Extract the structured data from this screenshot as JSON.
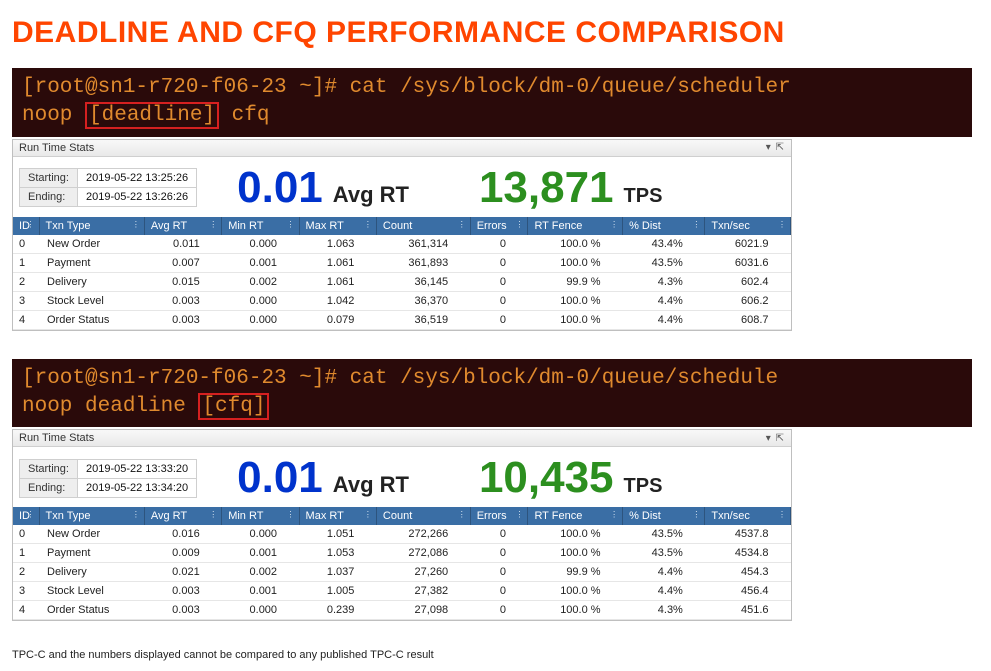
{
  "page": {
    "title": "DEADLINE AND CFQ PERFORMANCE COMPARISON",
    "footnote": "TPC-C and the numbers displayed cannot be compared to any published TPC-C result"
  },
  "panels": [
    {
      "terminal": {
        "line1_prompt": "[root@sn1-r720-f06-23 ~]# ",
        "line1_cmd": "cat /sys/block/dm-0/queue/scheduler",
        "line2_pre": "noop ",
        "line2_boxed": "[deadline]",
        "line2_post": " cfq"
      },
      "panel_title": "Run Time Stats",
      "times": {
        "starting_label": "Starting:",
        "starting": "2019-05-22 13:25:26",
        "ending_label": "Ending:",
        "ending": "2019-05-22 13:26:26"
      },
      "metrics": {
        "avg_rt": "0.01",
        "avg_rt_label": "Avg RT",
        "tps": "13,871",
        "tps_label": "TPS"
      },
      "columns": [
        "ID",
        "Txn Type",
        "Avg RT",
        "Min RT",
        "Max RT",
        "Count",
        "Errors",
        "RT Fence",
        "% Dist",
        "Txn/sec"
      ],
      "rows": [
        {
          "id": "0",
          "type": "New Order",
          "avg": "0.011",
          "min": "0.000",
          "max": "1.063",
          "count": "361,314",
          "errors": "0",
          "fence": "100.0 %",
          "dist": "43.4%",
          "tps": "6021.9"
        },
        {
          "id": "1",
          "type": "Payment",
          "avg": "0.007",
          "min": "0.001",
          "max": "1.061",
          "count": "361,893",
          "errors": "0",
          "fence": "100.0 %",
          "dist": "43.5%",
          "tps": "6031.6"
        },
        {
          "id": "2",
          "type": "Delivery",
          "avg": "0.015",
          "min": "0.002",
          "max": "1.061",
          "count": "36,145",
          "errors": "0",
          "fence": "99.9 %",
          "dist": "4.3%",
          "tps": "602.4"
        },
        {
          "id": "3",
          "type": "Stock Level",
          "avg": "0.003",
          "min": "0.000",
          "max": "1.042",
          "count": "36,370",
          "errors": "0",
          "fence": "100.0 %",
          "dist": "4.4%",
          "tps": "606.2"
        },
        {
          "id": "4",
          "type": "Order Status",
          "avg": "0.003",
          "min": "0.000",
          "max": "0.079",
          "count": "36,519",
          "errors": "0",
          "fence": "100.0 %",
          "dist": "4.4%",
          "tps": "608.7"
        }
      ]
    },
    {
      "terminal": {
        "line1_prompt": "[root@sn1-r720-f06-23 ~]# ",
        "line1_cmd": "cat /sys/block/dm-0/queue/schedule",
        "line2_pre": "noop deadline ",
        "line2_boxed": "[cfq]",
        "line2_post": ""
      },
      "panel_title": "Run Time Stats",
      "times": {
        "starting_label": "Starting:",
        "starting": "2019-05-22 13:33:20",
        "ending_label": "Ending:",
        "ending": "2019-05-22 13:34:20"
      },
      "metrics": {
        "avg_rt": "0.01",
        "avg_rt_label": "Avg RT",
        "tps": "10,435",
        "tps_label": "TPS"
      },
      "columns": [
        "ID",
        "Txn Type",
        "Avg RT",
        "Min RT",
        "Max RT",
        "Count",
        "Errors",
        "RT Fence",
        "% Dist",
        "Txn/sec"
      ],
      "rows": [
        {
          "id": "0",
          "type": "New Order",
          "avg": "0.016",
          "min": "0.000",
          "max": "1.051",
          "count": "272,266",
          "errors": "0",
          "fence": "100.0 %",
          "dist": "43.5%",
          "tps": "4537.8"
        },
        {
          "id": "1",
          "type": "Payment",
          "avg": "0.009",
          "min": "0.001",
          "max": "1.053",
          "count": "272,086",
          "errors": "0",
          "fence": "100.0 %",
          "dist": "43.5%",
          "tps": "4534.8"
        },
        {
          "id": "2",
          "type": "Delivery",
          "avg": "0.021",
          "min": "0.002",
          "max": "1.037",
          "count": "27,260",
          "errors": "0",
          "fence": "99.9 %",
          "dist": "4.4%",
          "tps": "454.3"
        },
        {
          "id": "3",
          "type": "Stock Level",
          "avg": "0.003",
          "min": "0.001",
          "max": "1.005",
          "count": "27,382",
          "errors": "0",
          "fence": "100.0 %",
          "dist": "4.4%",
          "tps": "456.4"
        },
        {
          "id": "4",
          "type": "Order Status",
          "avg": "0.003",
          "min": "0.000",
          "max": "0.239",
          "count": "27,098",
          "errors": "0",
          "fence": "100.0 %",
          "dist": "4.3%",
          "tps": "451.6"
        }
      ]
    }
  ]
}
